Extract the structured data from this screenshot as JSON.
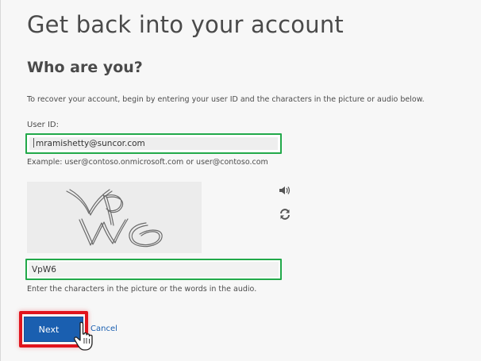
{
  "page": {
    "title": "Get back into your account",
    "subtitle": "Who are you?",
    "intro": "To recover your account, begin by entering your user ID and the characters in the picture or audio below."
  },
  "userid": {
    "label": "User ID:",
    "value": "mramishetty@suncor.com",
    "example": "Example: user@contoso.onmicrosoft.com or user@contoso.com"
  },
  "captcha": {
    "image_text": "VpW6",
    "value": "VpW6",
    "hint": "Enter the characters in the picture or the words in the audio.",
    "audio_icon": "speaker-icon",
    "refresh_icon": "refresh-icon"
  },
  "actions": {
    "next_label": "Next",
    "cancel_label": "Cancel"
  },
  "colors": {
    "accent": "#1a5fb0",
    "highlight_green": "#22a94a",
    "highlight_red": "#e0141c"
  }
}
